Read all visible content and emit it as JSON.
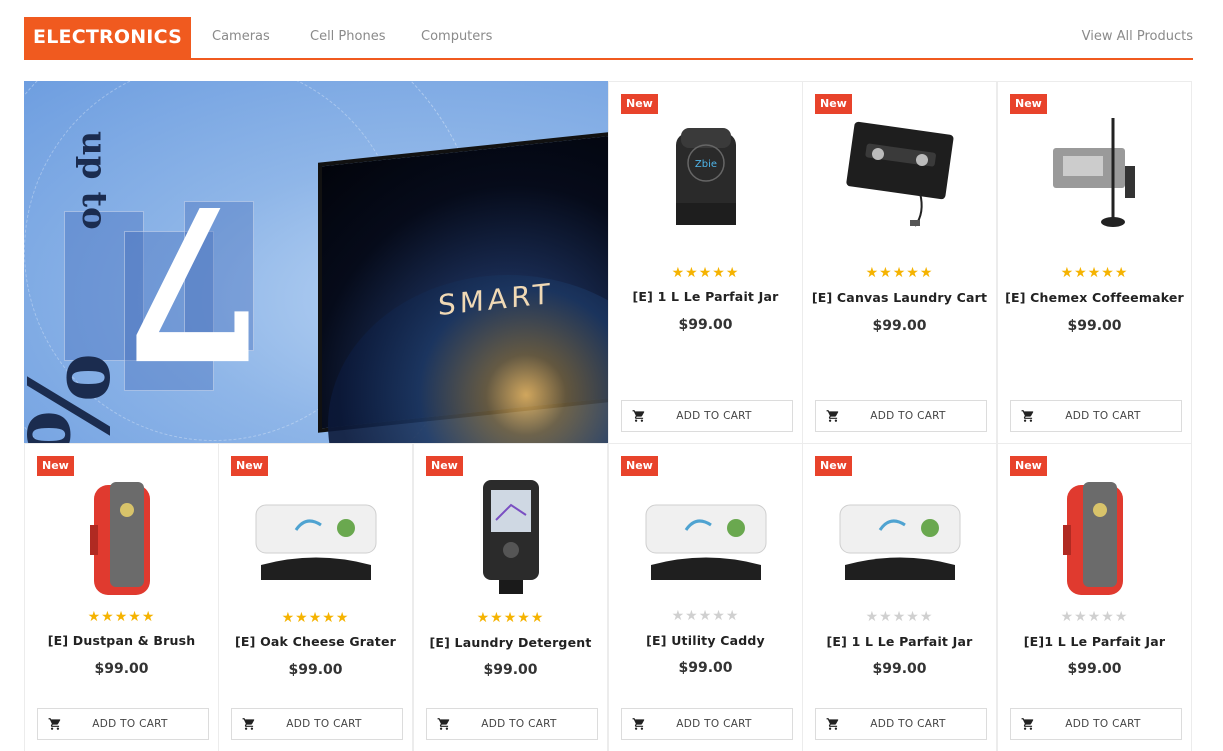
{
  "header": {
    "category_title": "ELECTRONICS",
    "tabs": [
      {
        "label": "Cameras"
      },
      {
        "label": "Cell Phones"
      },
      {
        "label": "Computers"
      }
    ],
    "view_all_label": "View All Products"
  },
  "banner": {
    "up_to_text": "up to",
    "percent_text": "%",
    "number_text": "7",
    "tv_text": "SMART"
  },
  "colors": {
    "accent": "#f05a1f",
    "badge": "#e8432b",
    "star_on": "#f5b301",
    "star_off": "#d0d0d0"
  },
  "products": [
    {
      "badge": "New",
      "name": "[E] 1 L Le Parfait Jar",
      "price": "$99.00",
      "rating": 5,
      "stars": "★★★★★",
      "image": "obd-dongle-icon",
      "cart_label": "ADD TO CART"
    },
    {
      "badge": "New",
      "name": "[E] Canvas Laundry Cart",
      "price": "$99.00",
      "rating": 5,
      "stars": "★★★★★",
      "image": "cassette-adapter-icon",
      "cart_label": "ADD TO CART"
    },
    {
      "badge": "New",
      "name": "[E] Chemex Coffeemaker",
      "price": "$99.00",
      "rating": 5,
      "stars": "★★★★★",
      "image": "signal-booster-icon",
      "cart_label": "ADD TO CART"
    },
    {
      "badge": "New",
      "name": "[E] Dustpan & Brush",
      "price": "$99.00",
      "rating": 5,
      "stars": "★★★★★",
      "image": "red-radio-icon",
      "cart_label": "ADD TO CART"
    },
    {
      "badge": "New",
      "name": "[E] Oak Cheese Grater",
      "price": "$99.00",
      "rating": 5,
      "stars": "★★★★★",
      "image": "hud-display-icon",
      "cart_label": "ADD TO CART"
    },
    {
      "badge": "New",
      "name": "[E] Laundry Detergent",
      "price": "$99.00",
      "rating": 5,
      "stars": "★★★★★",
      "image": "fish-finder-icon",
      "cart_label": "ADD TO CART"
    },
    {
      "badge": "New",
      "name": "[E] Utility Caddy",
      "price": "$99.00",
      "rating": 0,
      "stars": "★★★★★",
      "image": "hud-display-icon",
      "cart_label": "ADD TO CART"
    },
    {
      "badge": "New",
      "name": "[E] 1 L Le Parfait Jar",
      "price": "$99.00",
      "rating": 0,
      "stars": "★★★★★",
      "image": "hud-display-icon",
      "cart_label": "ADD TO CART"
    },
    {
      "badge": "New",
      "name": "[E]1 L Le Parfait Jar",
      "price": "$99.00",
      "rating": 0,
      "stars": "★★★★★",
      "image": "red-radio-icon",
      "cart_label": "ADD TO CART"
    }
  ]
}
